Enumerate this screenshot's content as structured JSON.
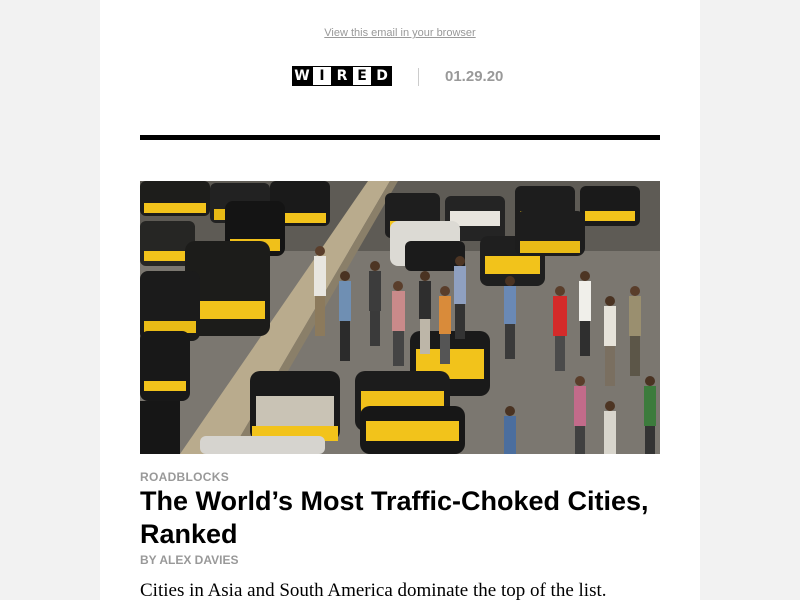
{
  "header": {
    "view_in_browser": "View this email in your browser",
    "logo_letters": [
      "W",
      "I",
      "R",
      "E",
      "D"
    ],
    "date": "01.29.20"
  },
  "article": {
    "kicker": "ROADBLOCKS",
    "headline": "The World’s Most Traffic-Choked Cities, Ranked",
    "byline": "BY ALEX DAVIES",
    "dek": "Cities in Asia and South America dominate the top of the list."
  },
  "colors": {
    "muted_text": "#999999",
    "rule": "#000000",
    "auto_rickshaw_yellow": "#f2c31b"
  },
  "icons": {
    "hero_image": "traffic-crowd-photo"
  }
}
